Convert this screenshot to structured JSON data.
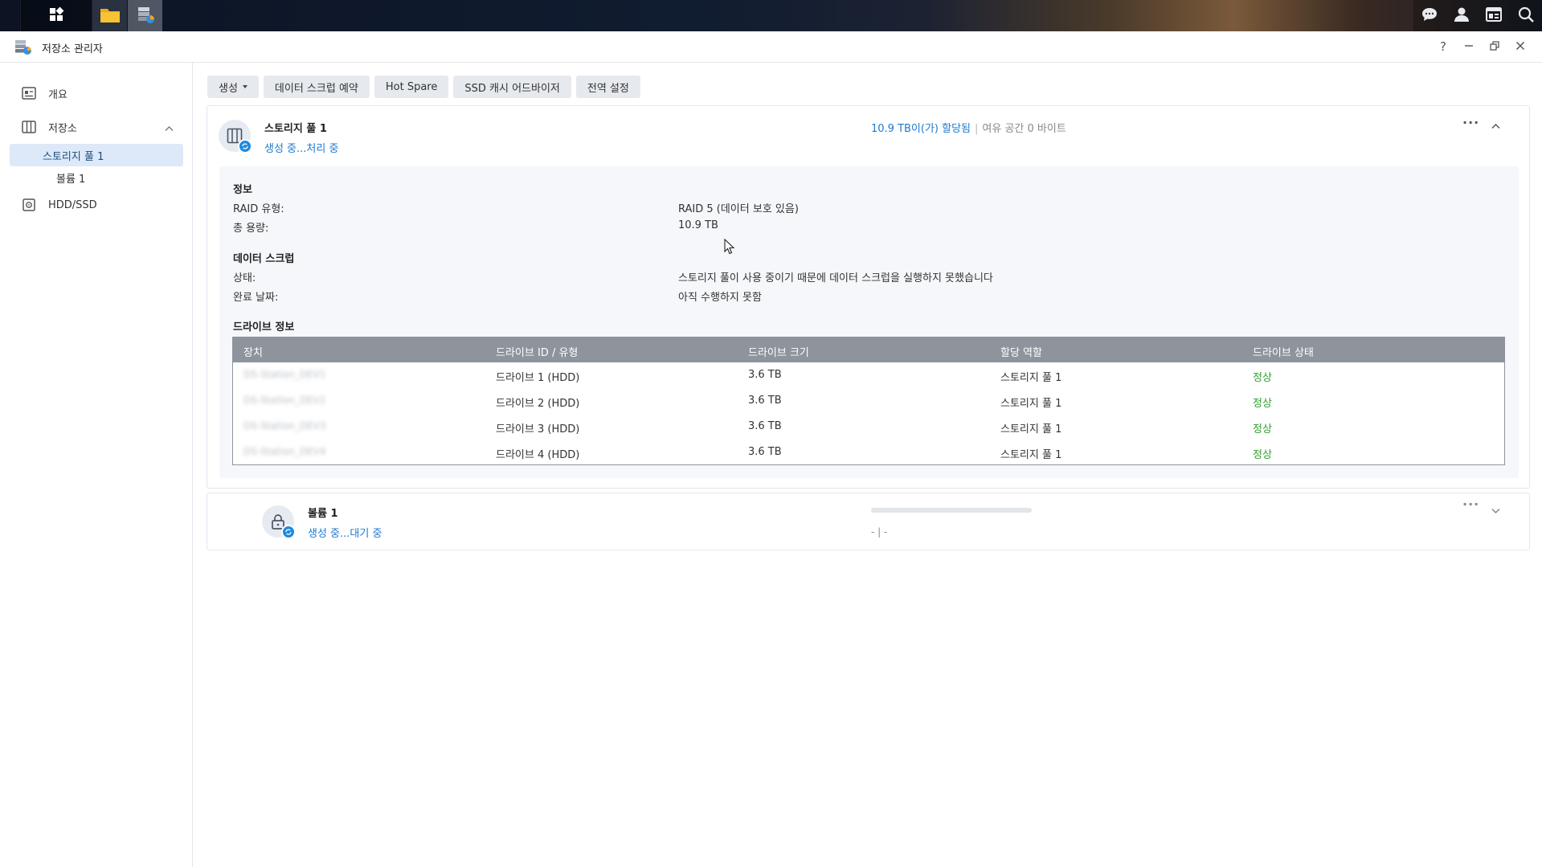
{
  "taskbar": {
    "left_icons": [
      "grid-icon",
      "file-station-icon",
      "storage-manager-icon"
    ],
    "right_icons": [
      "chat-icon",
      "user-icon",
      "widgets-icon",
      "search-icon"
    ]
  },
  "window": {
    "title": "저장소 관리자",
    "controls": {
      "help": "?"
    }
  },
  "sidebar": {
    "overview": "개요",
    "storage": "저장소",
    "storage_pool": "스토리지 풀 1",
    "volume": "볼륨 1",
    "hdd_ssd": "HDD/SSD"
  },
  "toolbar": {
    "create": "생성",
    "scrub_schedule": "데이터 스크럽 예약",
    "hot_spare": "Hot Spare",
    "ssd_cache": "SSD 캐시 어드바이저",
    "global_settings": "전역 설정"
  },
  "pool": {
    "name": "스토리지 풀 1",
    "status": "생성 중...처리 중",
    "allocated": "10.9 TB이(가) 할당됨",
    "separator": "|",
    "free": "여유 공간 0 바이트",
    "info": {
      "heading": "정보",
      "raid_label": "RAID 유형:",
      "raid_value": "RAID 5 (데이터 보호 있음)",
      "capacity_label": "총 용량:",
      "capacity_value": "10.9 TB"
    },
    "scrub": {
      "heading": "데이터 스크럽",
      "status_label": "상태:",
      "status_value": "스토리지 풀이 사용 중이기 때문에 데이터 스크럽을 실행하지 못했습니다",
      "date_label": "완료 날짜:",
      "date_value": "아직 수행하지 못함"
    },
    "drives": {
      "heading": "드라이브 정보",
      "columns": [
        "장치",
        "드라이브 ID / 유형",
        "드라이브 크기",
        "할당 역할",
        "드라이브 상태"
      ],
      "rows": [
        {
          "device": "DS-Station_DEV1",
          "id": "드라이브 1 (HDD)",
          "size": "3.6 TB",
          "role": "스토리지 풀 1",
          "status": "정상"
        },
        {
          "device": "DS-Station_DEV2",
          "id": "드라이브 2 (HDD)",
          "size": "3.6 TB",
          "role": "스토리지 풀 1",
          "status": "정상"
        },
        {
          "device": "DS-Station_DEV3",
          "id": "드라이브 3 (HDD)",
          "size": "3.6 TB",
          "role": "스토리지 풀 1",
          "status": "정상"
        },
        {
          "device": "DS-Station_DEV4",
          "id": "드라이브 4 (HDD)",
          "size": "3.6 TB",
          "role": "스토리지 풀 1",
          "status": "정상"
        }
      ]
    }
  },
  "volume": {
    "name": "볼륨 1",
    "status": "생성 중...대기 중",
    "usage": "- | -"
  },
  "colors": {
    "accent": "#1d7ad0",
    "ok": "#2ea02e",
    "table_header": "#8d949c"
  }
}
